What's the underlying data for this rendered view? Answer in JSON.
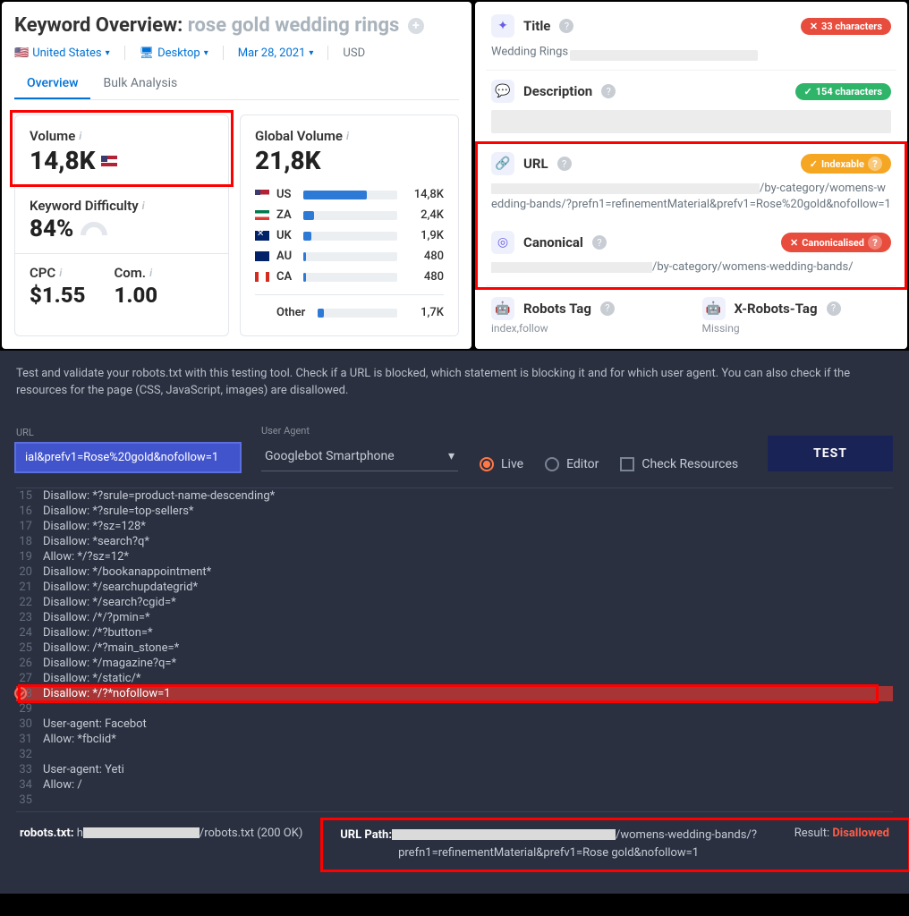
{
  "keyword_panel": {
    "title_prefix": "Keyword Overview:",
    "keyword": "rose gold wedding rings",
    "filters": {
      "country": "United States",
      "device": "Desktop",
      "date": "Mar 28, 2021",
      "currency": "USD"
    },
    "tabs": {
      "overview": "Overview",
      "bulk": "Bulk Analysis"
    },
    "volume": {
      "label": "Volume",
      "value": "14,8K"
    },
    "kd": {
      "label": "Keyword Difficulty",
      "value": "84%"
    },
    "cpc": {
      "label": "CPC",
      "value": "$1.55"
    },
    "com": {
      "label": "Com.",
      "value": "1.00"
    },
    "global": {
      "label": "Global Volume",
      "value": "21,8K",
      "rows": [
        {
          "cc": "US",
          "flag": "us",
          "val": "14,8K",
          "pct": 68
        },
        {
          "cc": "ZA",
          "flag": "za",
          "val": "2,4K",
          "pct": 11
        },
        {
          "cc": "UK",
          "flag": "uk",
          "val": "1,9K",
          "pct": 9
        },
        {
          "cc": "AU",
          "flag": "au",
          "val": "480",
          "pct": 3
        },
        {
          "cc": "CA",
          "flag": "ca",
          "val": "480",
          "pct": 3
        }
      ],
      "other_label": "Other",
      "other_val": "1,7K",
      "other_pct": 8
    }
  },
  "seo_panel": {
    "title": {
      "label": "Title",
      "badge": "33 characters",
      "value": "Wedding Rings"
    },
    "description": {
      "label": "Description",
      "badge": "154 characters"
    },
    "url": {
      "label": "URL",
      "badge": "Indexable",
      "text": "/by-category/womens-wedding-bands/?prefn1=refinementMaterial&prefv1=Rose%20gold&nofollow=1"
    },
    "canonical": {
      "label": "Canonical",
      "badge": "Canonicalised",
      "text": "/by-category/womens-wedding-bands/"
    },
    "robots": {
      "label": "Robots Tag",
      "value": "index,follow"
    },
    "xrobots": {
      "label": "X-Robots-Tag",
      "value": "Missing"
    }
  },
  "dark": {
    "desc": "Test and validate your robots.txt with this testing tool. Check if a URL is blocked, which statement is blocking it and for which user agent. You can also check if the resources for the page (CSS, JavaScript, images) are disallowed.",
    "url_label": "URL",
    "url_value": "ial&prefv1=Rose%20gold&nofollow=1",
    "ua_label": "User Agent",
    "ua_value": "Googlebot Smartphone",
    "live": "Live",
    "editor": "Editor",
    "check": "Check Resources",
    "test": "TEST",
    "lines": [
      {
        "n": 15,
        "t": "Disallow: *?srule=product-name-descending*"
      },
      {
        "n": 16,
        "t": "Disallow: *?srule=top-sellers*"
      },
      {
        "n": 17,
        "t": "Disallow: *?sz=128*"
      },
      {
        "n": 18,
        "t": "Disallow: *search?q*"
      },
      {
        "n": 19,
        "t": "Allow: */?sz=12*"
      },
      {
        "n": 20,
        "t": "Disallow: */bookanappointment*"
      },
      {
        "n": 21,
        "t": "Disallow: */searchupdategrid*"
      },
      {
        "n": 22,
        "t": "Disallow: */search?cgid=*"
      },
      {
        "n": 23,
        "t": "Disallow: /*/?pmin=*"
      },
      {
        "n": 24,
        "t": "Disallow: /*?button=*"
      },
      {
        "n": 25,
        "t": "Disallow: /*?main_stone=*"
      },
      {
        "n": 26,
        "t": "Disallow: */magazine?q=*"
      },
      {
        "n": 27,
        "t": "Disallow: */static/*"
      },
      {
        "n": 28,
        "t": "Disallow: */?*nofollow=1",
        "hl": true
      },
      {
        "n": 29,
        "t": ""
      },
      {
        "n": 30,
        "t": "User-agent: Facebot"
      },
      {
        "n": 31,
        "t": "Allow: *fbclid*"
      },
      {
        "n": 32,
        "t": ""
      },
      {
        "n": 33,
        "t": "User-agent: Yeti"
      },
      {
        "n": 34,
        "t": "Allow: /"
      },
      {
        "n": 35,
        "t": ""
      }
    ],
    "footer": {
      "robots_label": "robots.txt:",
      "robots_suffix": "/robots.txt (200 OK)",
      "path_label": "URL Path:",
      "path_text": "/womens-wedding-bands/?prefn1=refinementMaterial&prefv1=Rose gold&nofollow=1",
      "result_label": "Result:",
      "result_value": "Disallowed"
    }
  }
}
